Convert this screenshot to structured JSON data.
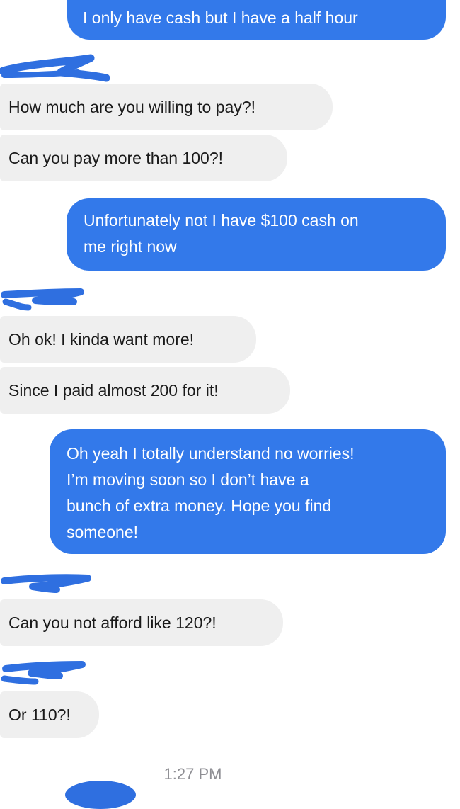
{
  "conversation": {
    "messages": [
      {
        "side": "outgoing",
        "text": "I only have cash but I have a half hour"
      },
      {
        "side": "incoming",
        "text": "How much are you willing to pay?!"
      },
      {
        "side": "incoming",
        "text": "Can you pay more than 100?!"
      },
      {
        "side": "outgoing",
        "lines": [
          "Unfortunately not I have $100 cash on",
          "me right now"
        ]
      },
      {
        "side": "incoming",
        "text": "Oh ok! I kinda want more!"
      },
      {
        "side": "incoming",
        "text": "Since I paid almost 200 for it!"
      },
      {
        "side": "outgoing",
        "lines": [
          "Oh yeah I totally understand no worries!",
          "I’m moving soon so I don’t have a",
          "bunch of extra money. Hope you find",
          "someone!"
        ]
      },
      {
        "side": "incoming",
        "text": "Can you not afford like 120?!"
      },
      {
        "side": "incoming",
        "text": "Or 110?!"
      }
    ],
    "timestamp": "1:27 PM"
  },
  "colors": {
    "outgoing_bubble": "#3379ea",
    "incoming_bubble": "#efefef",
    "redaction": "#2f6fe0",
    "timestamp": "#8e8e93"
  }
}
